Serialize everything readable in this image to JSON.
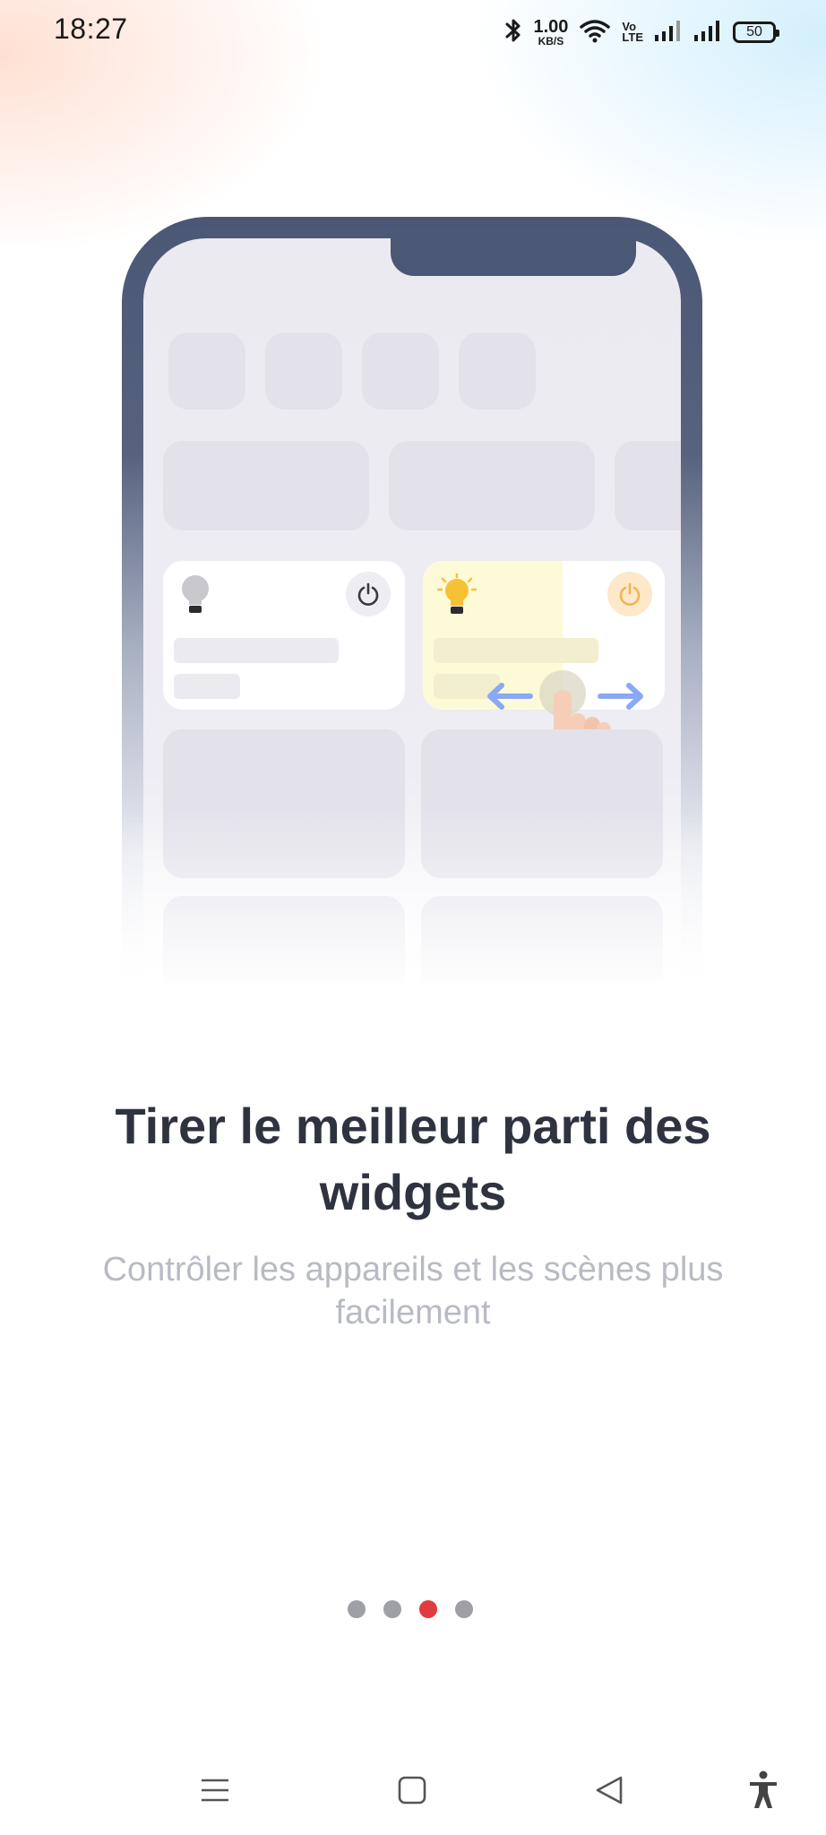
{
  "status_bar": {
    "time": "18:27",
    "network_speed_value": "1.00",
    "network_speed_unit": "KB/S",
    "volte_top": "Vo",
    "volte_bottom": "LTE",
    "battery_level": "50",
    "icons": [
      "bluetooth-icon",
      "wifi-icon",
      "volte-icon",
      "signal-icon",
      "signal-icon",
      "battery-icon"
    ]
  },
  "onboarding": {
    "title": "Tirer le meilleur parti des widgets",
    "subtitle": "Contrôler les appareils et les scènes plus facilement",
    "page_count": 4,
    "current_page": 3
  },
  "illustration": {
    "icons": [
      "bulb-off-icon",
      "power-icon",
      "bulb-on-icon",
      "power-icon",
      "arrow-left-icon",
      "arrow-right-icon",
      "hand-pointer-icon"
    ],
    "colors": {
      "frame": "#4a5875",
      "bulb_on": "#f6c234",
      "widget_on_bg": "#fdfad8",
      "arrow": "#8aa8f4",
      "hand": "#f6cdb8"
    }
  },
  "nav_bar": {
    "buttons": [
      "menu-icon",
      "home-icon",
      "back-icon",
      "accessibility-icon"
    ]
  },
  "colors": {
    "accent_dot": "#e03c3e",
    "inactive_dot": "#9ea0a6",
    "title": "#2f3340",
    "subtitle": "#b8bbc4"
  }
}
